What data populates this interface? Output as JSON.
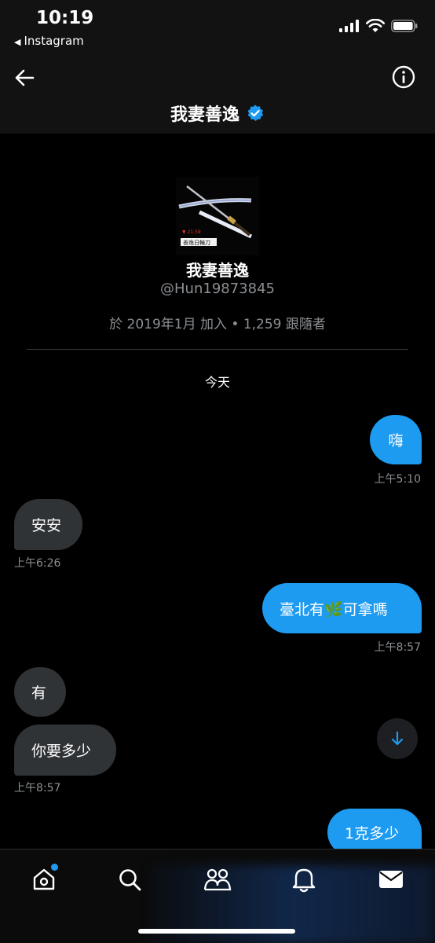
{
  "status_bar": {
    "time": "10:19",
    "back_app": "Instagram"
  },
  "header": {
    "title": "我妻善逸",
    "verified": true
  },
  "profile": {
    "name": "我妻善逸",
    "handle": "@Hun19873845",
    "meta": "於 2019年1月 加入 • 1,259 跟隨者",
    "image_caption": "善逸日輪刀"
  },
  "conversation": {
    "day_label": "今天",
    "messages": [
      {
        "direction": "out",
        "text": "嗨",
        "time": "上午5:10"
      },
      {
        "direction": "in",
        "text": "安安",
        "time": "上午6:26"
      },
      {
        "direction": "out",
        "text": "臺北有🌿可拿嗎",
        "time": "上午8:57"
      },
      {
        "direction": "in",
        "text": "有",
        "time": ""
      },
      {
        "direction": "in",
        "text": "你要多少",
        "time": "上午8:57"
      },
      {
        "direction": "out",
        "text": "1克多少",
        "time": ""
      }
    ]
  },
  "bottom_nav": {
    "items": [
      "home-icon",
      "search-icon",
      "communities-icon",
      "notifications-icon",
      "messages-icon"
    ],
    "home_has_notification": true
  },
  "colors": {
    "accent": "#1d9bf0",
    "incoming_bubble": "#2f3336",
    "background": "#000000"
  }
}
